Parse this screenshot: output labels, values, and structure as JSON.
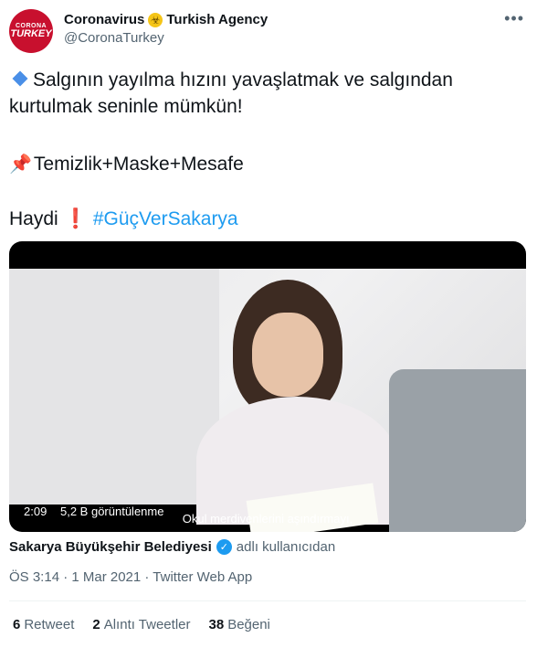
{
  "author": {
    "avatar_line1": "CORONA",
    "avatar_line2": "TURKEY",
    "name_part1": "Coronavirus",
    "name_part2": "Turkish Agency",
    "handle": "@CoronaTurkey"
  },
  "tweet": {
    "line1": "Salgının yayılma hızını yavaşlatmak ve salgından kurtulmak seninle mümkün!",
    "line2": "Temizlik+Maske+Mesafe",
    "line3_prefix": "Haydi",
    "hashtag": "#GüçVerSakarya"
  },
  "media": {
    "duration": "2:09",
    "views": "5,2 B görüntülenme",
    "subtitle": "Okul merdivenlerini aşındırmayı,"
  },
  "source": {
    "name": "Sakarya Büyükşehir Belediyesi",
    "suffix": "adlı kullanıcıdan"
  },
  "meta": "ÖS 3:14 · 1 Mar 2021 · Twitter Web App",
  "stats": [
    {
      "count": "6",
      "label": "Retweet"
    },
    {
      "count": "2",
      "label": "Alıntı Tweetler"
    },
    {
      "count": "38",
      "label": "Beğeni"
    }
  ],
  "colors": {
    "accent": "#1d9bf0",
    "brand": "#c8102e"
  },
  "icons": [
    "biohazard-icon",
    "diamond-icon",
    "pushpin-icon",
    "exclamation-icon",
    "verified-icon",
    "more-icon"
  ]
}
